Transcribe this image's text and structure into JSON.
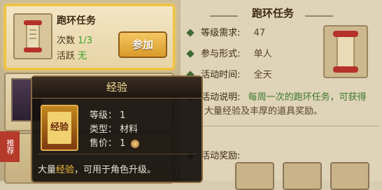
{
  "task_card": {
    "title": "跑环任务",
    "count_label": "次数",
    "count_value": "1/3",
    "active_label": "活跃",
    "active_value": "无",
    "add_button": "参加"
  },
  "left_list": {
    "ribbon_label": "推荐"
  },
  "detail": {
    "title": "跑环任务",
    "rows": [
      {
        "label": "等级需求:",
        "value": "47"
      },
      {
        "label": "参与形式:",
        "value": "单人"
      },
      {
        "label": "活动时间:",
        "value": "全天"
      },
      {
        "label": "活动说明:",
        "value": "每周一次的跑环任务，可获得"
      },
      {
        "label": "",
        "value": "大量经验及丰厚的道具奖励。"
      }
    ],
    "reward_label": "活动奖励:"
  },
  "tooltip": {
    "title": "经验",
    "icon_text": "经验",
    "level_label": "等级：",
    "level_value": "1",
    "type_label": "类型：",
    "type_value": "材料",
    "price_label": "售价：",
    "price_value": "1",
    "desc_pre": "大量",
    "desc_hl": "经验",
    "desc_post": "，可用于角色升级。"
  }
}
